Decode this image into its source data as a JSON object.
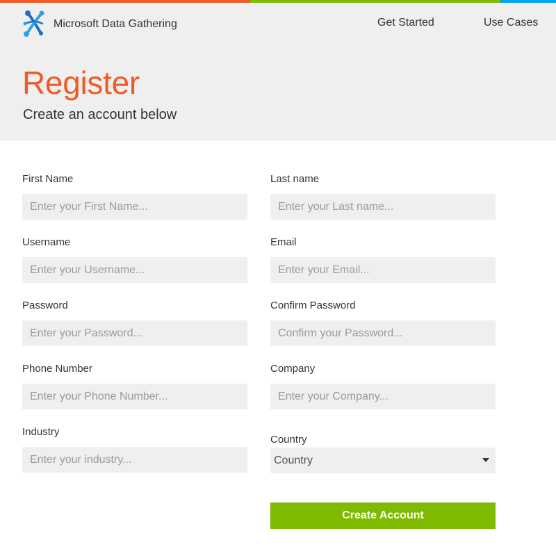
{
  "topbar": {
    "colors": [
      "#f05a28",
      "#7fba00",
      "#00a4ef"
    ]
  },
  "header": {
    "brand": "Microsoft Data Gathering",
    "logo_icon": "molecule-x-logo-icon",
    "nav": {
      "get_started": "Get Started",
      "use_cases": "Use Cases"
    },
    "title": "Register",
    "subtitle": "Create an account below",
    "title_color": "#f05a28"
  },
  "form": {
    "first_name": {
      "label": "First Name",
      "placeholder": "Enter your First Name..."
    },
    "last_name": {
      "label": "Last name",
      "placeholder": "Enter your Last name..."
    },
    "username": {
      "label": "Username",
      "placeholder": "Enter your Username..."
    },
    "email": {
      "label": "Email",
      "placeholder": "Enter your Email..."
    },
    "password": {
      "label": "Password",
      "placeholder": "Enter your Password..."
    },
    "confirm_password": {
      "label": "Confirm Password",
      "placeholder": "Confirm your Password..."
    },
    "phone": {
      "label": "Phone Number",
      "placeholder": "Enter your Phone Number..."
    },
    "company": {
      "label": "Company",
      "placeholder": "Enter your Company..."
    },
    "industry": {
      "label": "Industry",
      "placeholder": "Enter your industry..."
    },
    "country": {
      "label": "Country",
      "selected": "Country"
    },
    "submit_label": "Create Account",
    "submit_color": "#7fba00"
  }
}
